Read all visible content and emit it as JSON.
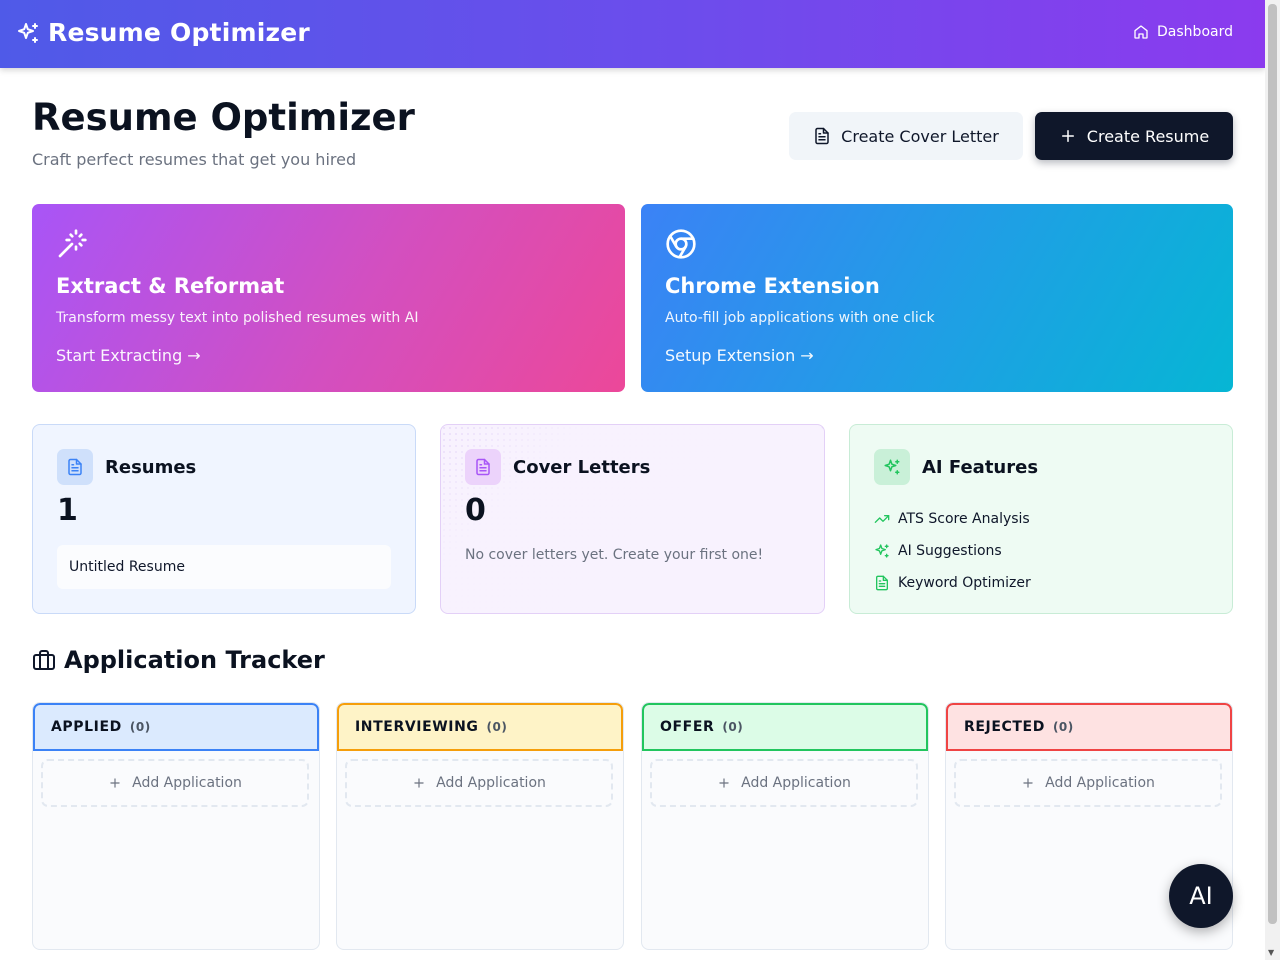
{
  "header": {
    "brand": "Resume Optimizer",
    "nav_dashboard": "Dashboard"
  },
  "page": {
    "title": "Resume Optimizer",
    "subtitle": "Craft perfect resumes that get you hired"
  },
  "actions": {
    "cover_letter": "Create Cover Letter",
    "resume": "Create Resume"
  },
  "features": [
    {
      "title": "Extract & Reformat",
      "desc": "Transform messy text into polished resumes with AI",
      "link": "Start Extracting →",
      "icon": "magic-wand-icon"
    },
    {
      "title": "Chrome Extension",
      "desc": "Auto-fill job applications with one click",
      "link": "Setup Extension →",
      "icon": "chrome-icon"
    }
  ],
  "stats": {
    "resumes": {
      "title": "Resumes",
      "count": "1",
      "items": [
        "Untitled Resume"
      ]
    },
    "covers": {
      "title": "Cover Letters",
      "count": "0",
      "empty": "No cover letters yet. Create your first one!"
    },
    "ai": {
      "title": "AI Features",
      "items": [
        "ATS Score Analysis",
        "AI Suggestions",
        "Keyword Optimizer"
      ]
    }
  },
  "tracker": {
    "title": "Application Tracker",
    "add_label": "Add Application",
    "columns": [
      {
        "label": "APPLIED",
        "count": "(0)",
        "border": "#3b82f6",
        "bg": "#dbeafe"
      },
      {
        "label": "INTERVIEWING",
        "count": "(0)",
        "border": "#f59e0b",
        "bg": "#fef3c7"
      },
      {
        "label": "OFFER",
        "count": "(0)",
        "border": "#22c55e",
        "bg": "#dcfce7"
      },
      {
        "label": "REJECTED",
        "count": "(0)",
        "border": "#ef4444",
        "bg": "#fee2e2"
      }
    ]
  },
  "fab": {
    "label": "AI"
  },
  "colors": {
    "primary": "#0f172a",
    "header_start": "#4f5ae8",
    "header_end": "#8b3bee"
  }
}
